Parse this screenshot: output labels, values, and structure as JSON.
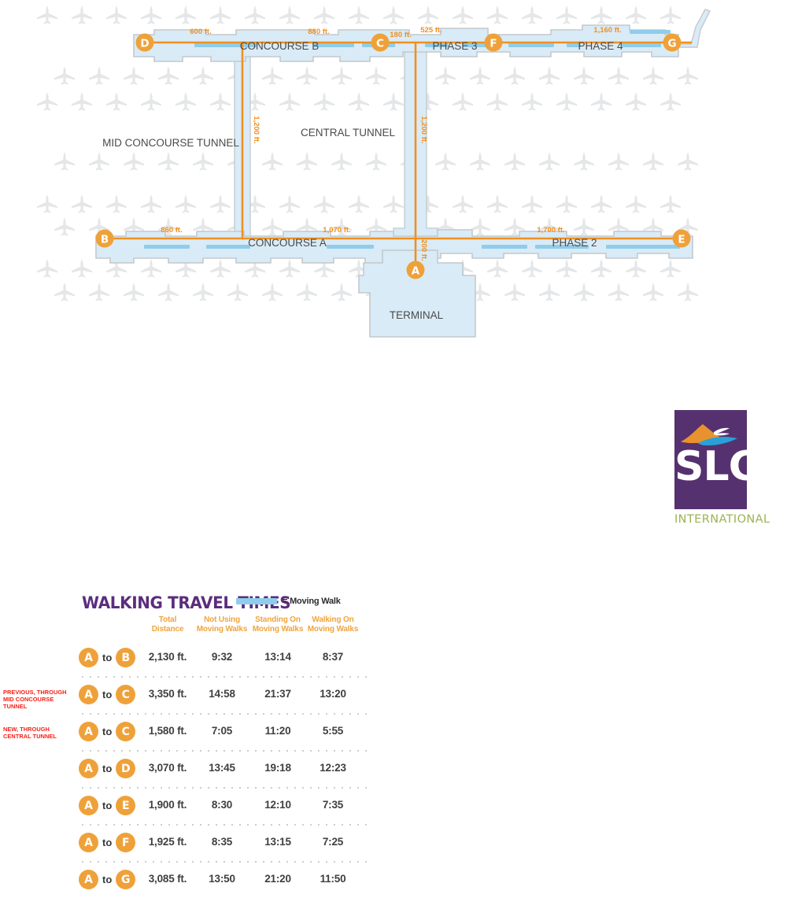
{
  "map": {
    "concourses": [
      {
        "id": "concourse-b",
        "label": "CONCOURSE B"
      },
      {
        "id": "phase-3",
        "label": "PHASE 3"
      },
      {
        "id": "phase-4",
        "label": "PHASE 4"
      },
      {
        "id": "concourse-a",
        "label": "CONCOURSE A"
      },
      {
        "id": "phase-2",
        "label": "PHASE 2"
      },
      {
        "id": "terminal",
        "label": "TERMINAL"
      }
    ],
    "tunnels": [
      {
        "id": "mid-concourse-tunnel",
        "label": "MID CONCOURSE TUNNEL",
        "length": "1,200 ft."
      },
      {
        "id": "central-tunnel",
        "label": "CENTRAL TUNNEL",
        "length": "1,200 ft."
      }
    ],
    "markers": [
      {
        "id": "marker-d",
        "label": "D"
      },
      {
        "id": "marker-c",
        "label": "C"
      },
      {
        "id": "marker-f",
        "label": "F"
      },
      {
        "id": "marker-g",
        "label": "G"
      },
      {
        "id": "marker-b",
        "label": "B"
      },
      {
        "id": "marker-a",
        "label": "A"
      },
      {
        "id": "marker-e",
        "label": "E"
      }
    ],
    "distances": {
      "d_to_b_junction": "600 ft.",
      "b_junction_to_c": "880 ft.",
      "c_to_central": "180 ft.",
      "central_to_f": "525 ft.",
      "f_to_g": "1,160 ft.",
      "b_to_mid": "860 ft.",
      "mid_to_central": "1,070 ft.",
      "central_to_e": "1,700 ft.",
      "mid_tunnel": "1,200 ft.",
      "central_tunnel": "1,200 ft.",
      "a_spur": "200 ft."
    }
  },
  "panel": {
    "title": "WALKING TRAVEL TIMES",
    "legend_label": "= Moving Walk",
    "legend_color": "#8fcdea"
  },
  "table": {
    "headers": [
      {
        "line1": "Total",
        "line2": "Distance"
      },
      {
        "line1": "Not Using",
        "line2": "Moving Walks"
      },
      {
        "line1": "Standing On",
        "line2": "Moving Walks"
      },
      {
        "line1": "Walking On",
        "line2": "Moving Walks"
      }
    ],
    "rows": [
      {
        "note": "",
        "from": "A",
        "to_word": "to",
        "to": "B",
        "distance": "2,130 ft.",
        "not_using": "9:32",
        "standing": "13:14",
        "walking": "8:37"
      },
      {
        "note": "PREVIOUS, THROUGH MID CONCOURSE TUNNEL",
        "from": "A",
        "to_word": "to",
        "to": "C",
        "distance": "3,350 ft.",
        "not_using": "14:58",
        "standing": "21:37",
        "walking": "13:20"
      },
      {
        "note": "NEW, THROUGH CENTRAL TUNNEL",
        "from": "A",
        "to_word": "to",
        "to": "C",
        "distance": "1,580 ft.",
        "not_using": "7:05",
        "standing": "11:20",
        "walking": "5:55"
      },
      {
        "note": "",
        "from": "A",
        "to_word": "to",
        "to": "D",
        "distance": "3,070 ft.",
        "not_using": "13:45",
        "standing": "19:18",
        "walking": "12:23"
      },
      {
        "note": "",
        "from": "A",
        "to_word": "to",
        "to": "E",
        "distance": "1,900 ft.",
        "not_using": "8:30",
        "standing": "12:10",
        "walking": "7:35"
      },
      {
        "note": "",
        "from": "A",
        "to_word": "to",
        "to": "F",
        "distance": "1,925 ft.",
        "not_using": "8:35",
        "standing": "13:15",
        "walking": "7:25"
      },
      {
        "note": "",
        "from": "A",
        "to_word": "to",
        "to": "G",
        "distance": "3,085 ft.",
        "not_using": "13:50",
        "standing": "21:20",
        "walking": "11:50"
      }
    ]
  },
  "logo": {
    "name": "SLC",
    "subtitle": "INTERNATIONAL",
    "plate_color": "#56316f",
    "mountain_color": "#e8922f",
    "swoosh_color": "#2aa0d8",
    "subtitle_color": "#9cb352"
  },
  "colors": {
    "route_orange": "#f09020",
    "marker_orange": "#efa139",
    "building_fill": "#d9ebf7",
    "building_stroke": "#c3c9cc",
    "moving_walk": "#8fcdea",
    "title_purple": "#5b2d7e",
    "note_red": "#f91c13"
  }
}
